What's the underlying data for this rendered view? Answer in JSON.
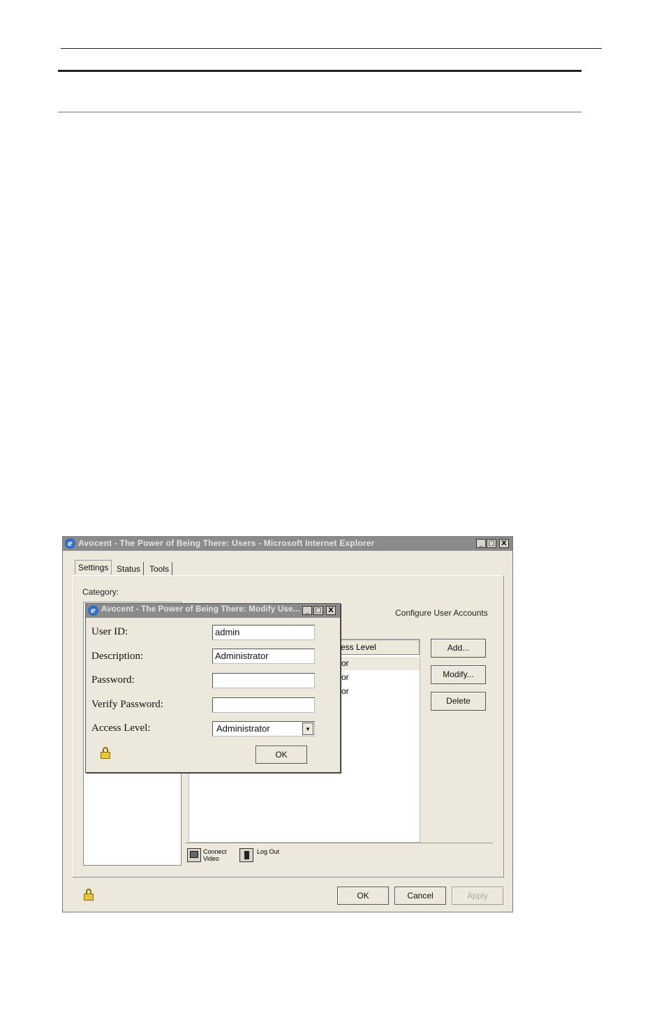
{
  "main_window": {
    "title": "Avocent - The Power of Being There: Users - Microsoft Internet Explorer",
    "controls": {
      "minimize": "_",
      "maximize": "□",
      "close": "X"
    },
    "tabs": [
      "Settings",
      "Status",
      "Tools"
    ],
    "category_label": "Category:",
    "section_title": "Configure User Accounts",
    "table": {
      "header": "ccess Level",
      "rows": [
        "rator",
        "rator",
        "rator"
      ]
    },
    "buttons": {
      "add": "Add...",
      "modify": "Modify...",
      "delete": "Delete"
    },
    "footer_icons": {
      "connect": "Connect\nVideo",
      "logout": "Log Out"
    },
    "bottom_buttons": {
      "ok": "OK",
      "cancel": "Cancel",
      "apply": "Apply"
    }
  },
  "dialog": {
    "title": "Avocent - The Power of Being There: Modify Use...",
    "fields": {
      "user_id": {
        "label": "User ID:",
        "value": "admin"
      },
      "description": {
        "label": "Description:",
        "value": "Administrator"
      },
      "password": {
        "label": "Password:",
        "value": ""
      },
      "verify_password": {
        "label": "Verify Password:",
        "value": ""
      },
      "access_level": {
        "label": "Access Level:",
        "value": "Administrator"
      }
    },
    "ok_label": "OK"
  }
}
